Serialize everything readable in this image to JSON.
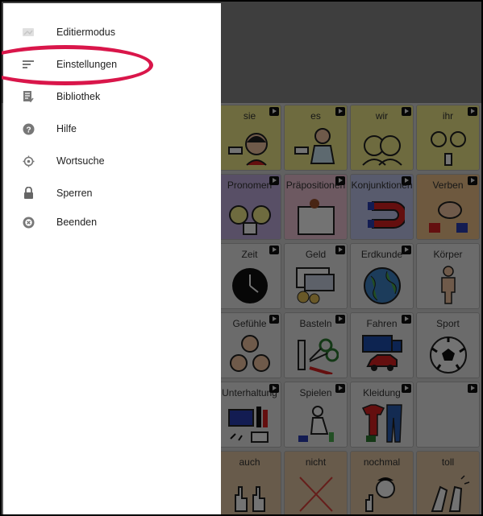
{
  "drawer": {
    "items": [
      {
        "label": "Editiermodus",
        "icon": "edit-mode-icon"
      },
      {
        "label": "Einstellungen",
        "icon": "settings-lines-icon"
      },
      {
        "label": "Bibliothek",
        "icon": "library-icon"
      },
      {
        "label": "Hilfe",
        "icon": "help-icon"
      },
      {
        "label": "Wortsuche",
        "icon": "word-search-icon"
      },
      {
        "label": "Sperren",
        "icon": "lock-icon"
      },
      {
        "label": "Beenden",
        "icon": "exit-icon"
      }
    ],
    "highlight_color": "#d9164a"
  },
  "board": {
    "rows": [
      [
        {
          "label": "sie",
          "color": "#f3ee8d"
        },
        {
          "label": "es",
          "color": "#f3ee8d"
        },
        {
          "label": "wir",
          "color": "#f3ee8d"
        },
        {
          "label": "ihr",
          "color": "#f3ee8d"
        }
      ],
      [
        {
          "label": "Pronomen",
          "color": "#c4b0e3"
        },
        {
          "label": "Präpositionen",
          "color": "#f1c6d8"
        },
        {
          "label": "Konjunktionen",
          "color": "#c3c9f2"
        },
        {
          "label": "Verben",
          "color": "#f3c68c"
        }
      ],
      [
        {
          "label": "Zeit",
          "color": "#eeeeee"
        },
        {
          "label": "Geld",
          "color": "#eeeeee"
        },
        {
          "label": "Erdkunde",
          "color": "#eeeeee"
        },
        {
          "label": "Körper",
          "color": "#eeeeee"
        }
      ],
      [
        {
          "label": "Gefühle",
          "color": "#eeeeee"
        },
        {
          "label": "Basteln",
          "color": "#eeeeee"
        },
        {
          "label": "Fahren",
          "color": "#eeeeee"
        },
        {
          "label": "Sport",
          "color": "#eeeeee"
        }
      ],
      [
        {
          "label": "Unterhaltung",
          "color": "#eeeeee"
        },
        {
          "label": "Spielen",
          "color": "#eeeeee"
        },
        {
          "label": "Kleidung",
          "color": "#eeeeee"
        },
        {
          "label": "",
          "color": "#eeeeee"
        }
      ],
      [
        {
          "label": "auch",
          "color": "#e6c9a6"
        },
        {
          "label": "nicht",
          "color": "#e6c9a6"
        },
        {
          "label": "nochmal",
          "color": "#e6c9a6"
        },
        {
          "label": "toll",
          "color": "#e6c9a6"
        }
      ]
    ]
  }
}
